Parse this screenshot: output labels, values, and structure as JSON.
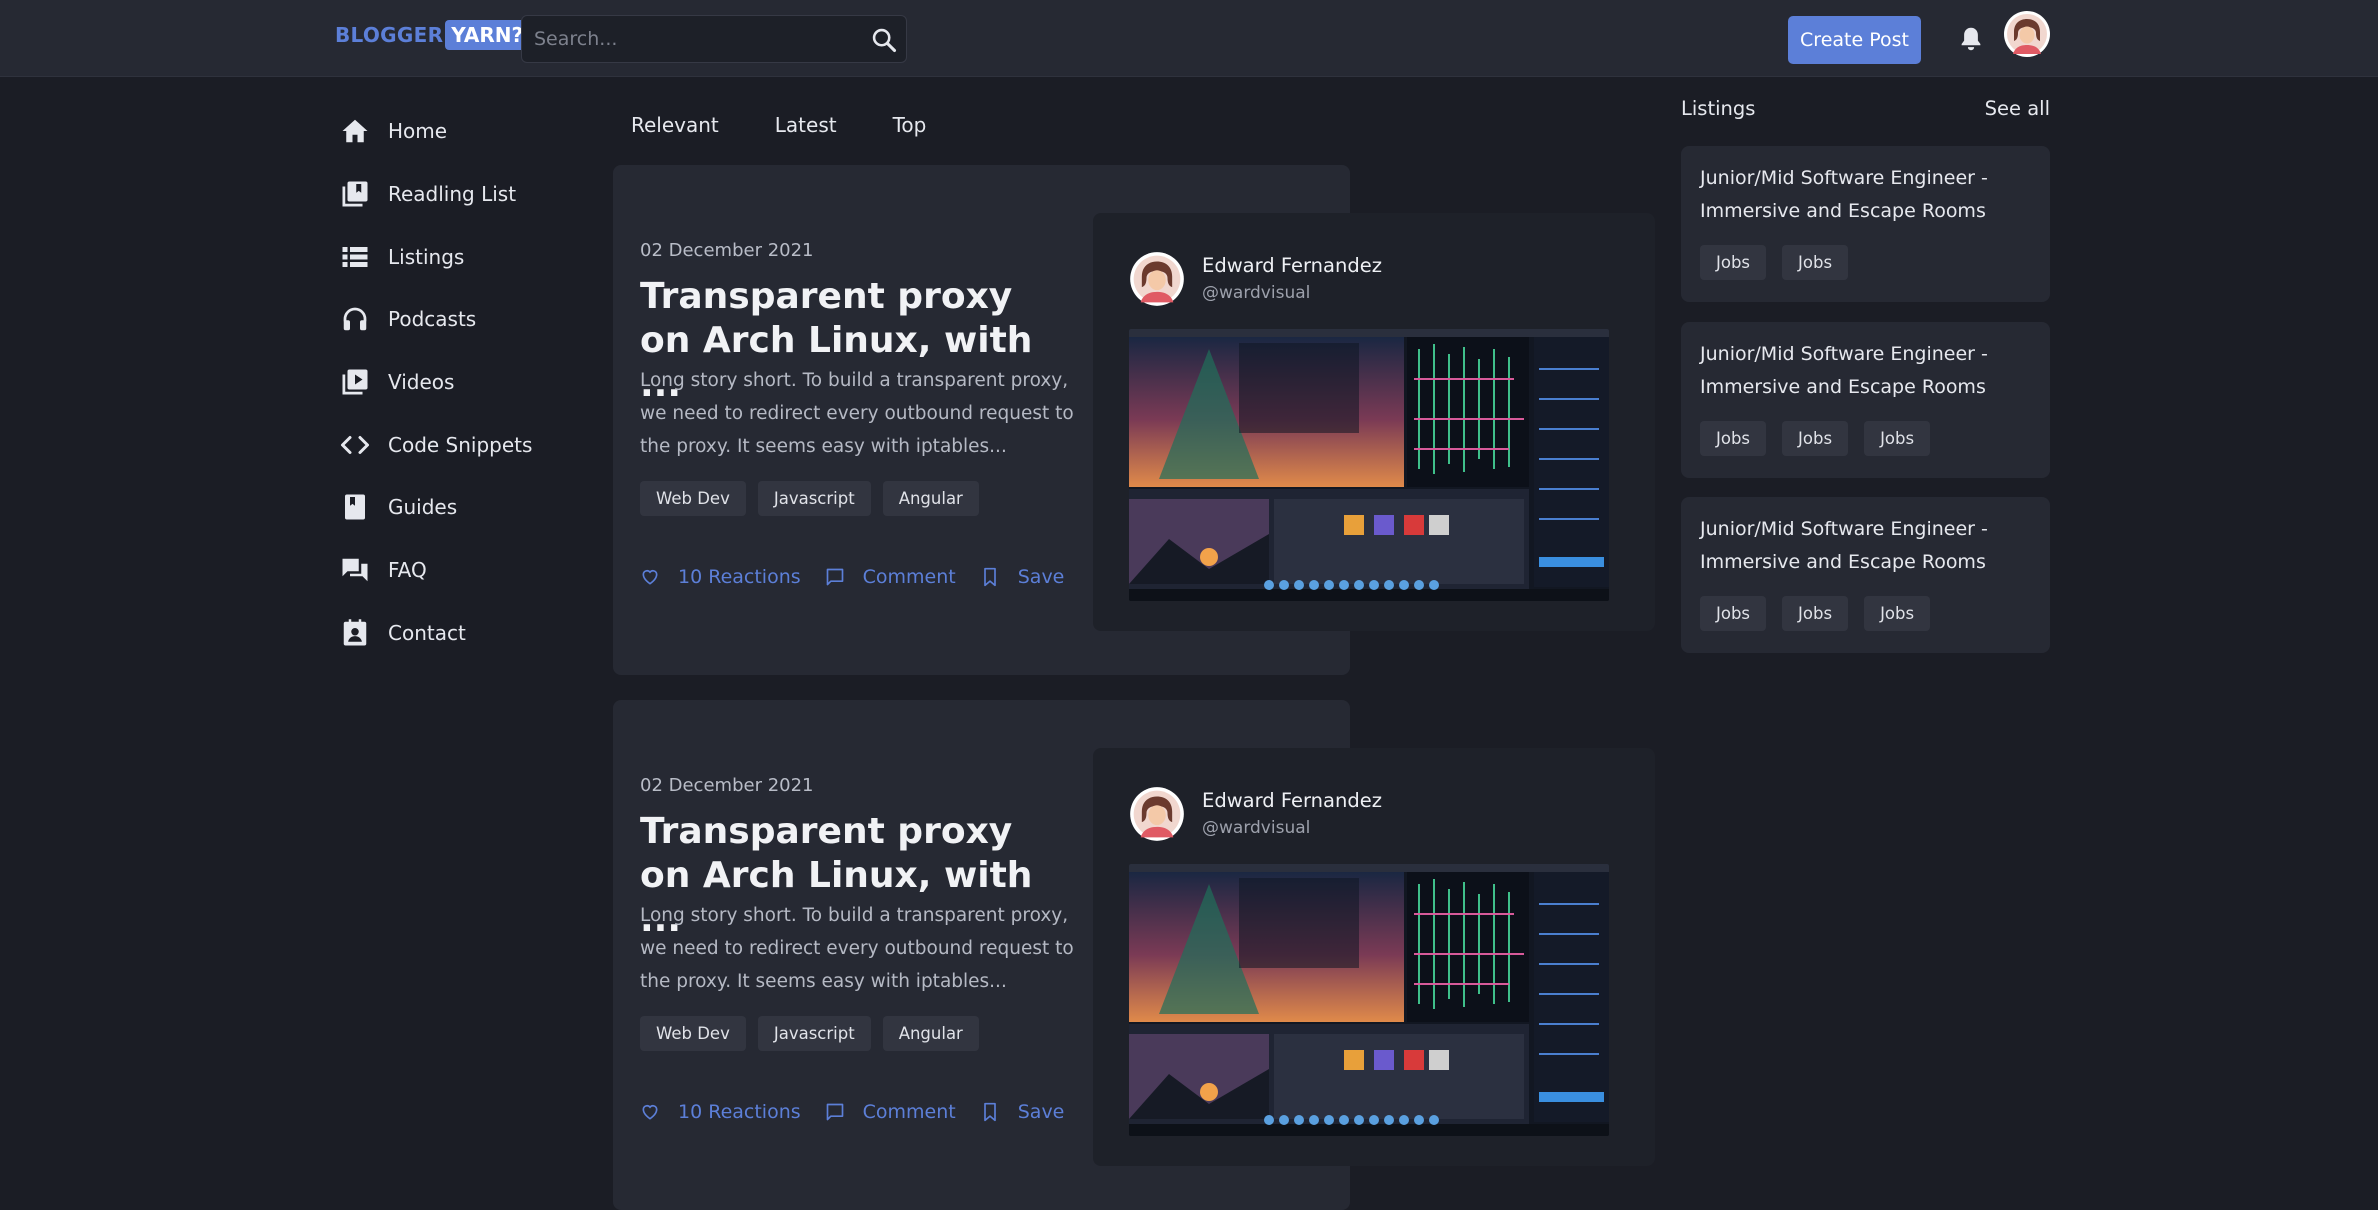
{
  "header": {
    "logo_part1": "BLOGGER",
    "logo_part2": "YARN?",
    "search_placeholder": "Search...",
    "create_post_label": "Create Post",
    "accent_color": "#5c7fd8"
  },
  "sidebar": {
    "items": [
      {
        "label": "Home",
        "icon": "home-icon"
      },
      {
        "label": "Readling List",
        "icon": "reading-list-icon"
      },
      {
        "label": "Listings",
        "icon": "listings-icon"
      },
      {
        "label": "Podcasts",
        "icon": "headphones-icon"
      },
      {
        "label": "Videos",
        "icon": "video-icon"
      },
      {
        "label": "Code Snippets",
        "icon": "code-icon"
      },
      {
        "label": "Guides",
        "icon": "book-icon"
      },
      {
        "label": "FAQ",
        "icon": "faq-icon"
      },
      {
        "label": "Contact",
        "icon": "contact-icon"
      }
    ]
  },
  "feed": {
    "tabs": [
      "Relevant",
      "Latest",
      "Top"
    ],
    "posts": [
      {
        "date": "02 December 2021",
        "title": "Transparent proxy on Arch Linux, with ...",
        "excerpt": "Long story short. To build a transparent proxy, we need to redirect every outbound request to the proxy. It seems easy with iptables...",
        "tags": [
          "Web Dev",
          "Javascript",
          "Angular"
        ],
        "reactions_label": "10 Reactions",
        "comment_label": "Comment",
        "save_label": "Save",
        "author_name": "Edward Fernandez",
        "author_handle": "@wardvisual"
      },
      {
        "date": "02 December 2021",
        "title": "Transparent proxy on Arch Linux, with ...",
        "excerpt": "Long story short. To build a transparent proxy, we need to redirect every outbound request to the proxy. It seems easy with iptables...",
        "tags": [
          "Web Dev",
          "Javascript",
          "Angular"
        ],
        "reactions_label": "10 Reactions",
        "comment_label": "Comment",
        "save_label": "Save",
        "author_name": "Edward Fernandez",
        "author_handle": "@wardvisual"
      }
    ]
  },
  "listings": {
    "title": "Listings",
    "see_all_label": "See all",
    "items": [
      {
        "title": "Junior/Mid Software Engineer - Immersive and Escape Rooms",
        "tags": [
          "Jobs",
          "Jobs"
        ]
      },
      {
        "title": "Junior/Mid Software Engineer - Immersive and Escape Rooms",
        "tags": [
          "Jobs",
          "Jobs",
          "Jobs"
        ]
      },
      {
        "title": "Junior/Mid Software Engineer - Immersive and Escape Rooms",
        "tags": [
          "Jobs",
          "Jobs",
          "Jobs"
        ]
      }
    ]
  }
}
